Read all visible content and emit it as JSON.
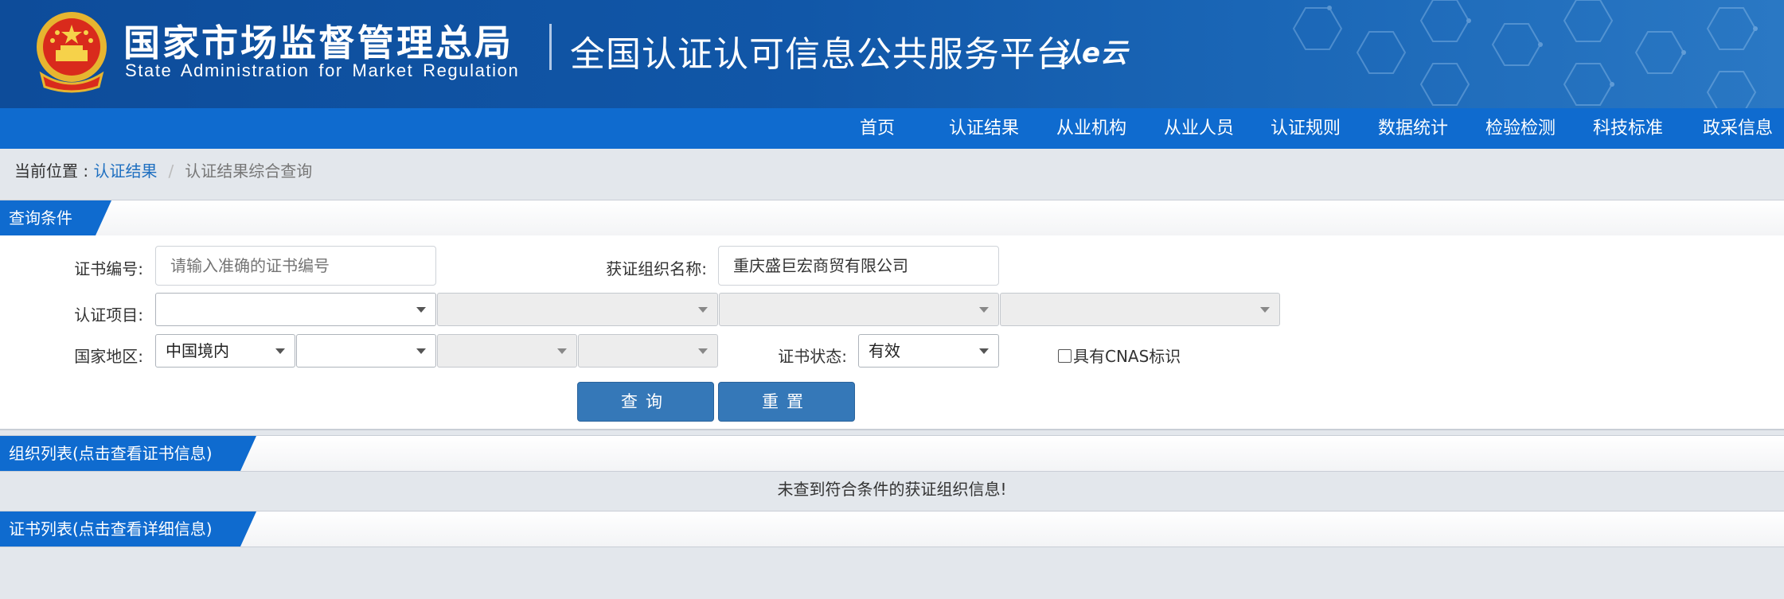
{
  "header": {
    "org_name_cn": "国家市场监督管理总局",
    "org_name_en": "State Administration  for  Market Regulation",
    "platform_title": "全国认证认可信息公共服务平台",
    "logo_text": "认e云",
    "colors": {
      "header_bg": "#1157a8",
      "nav_bg": "#0f6bcf",
      "accent": "#1e6fc0"
    }
  },
  "nav": {
    "items": [
      {
        "label": "首页"
      },
      {
        "label": "认证结果"
      },
      {
        "label": "从业机构"
      },
      {
        "label": "从业人员"
      },
      {
        "label": "认证规则"
      },
      {
        "label": "数据统计"
      },
      {
        "label": "检验检测"
      },
      {
        "label": "科技标准"
      },
      {
        "label": "政采信息"
      }
    ]
  },
  "breadcrumb": {
    "prefix": "当前位置 : ",
    "link": "认证结果",
    "separator": "/",
    "current": "认证结果综合查询"
  },
  "query_panel": {
    "title": "查询条件",
    "cert_no_label": "证书编号:",
    "cert_no_placeholder": "请输入准确的证书编号",
    "cert_no_value": "",
    "org_name_label": "获证组织名称:",
    "org_name_value": "重庆盛巨宏商贸有限公司",
    "project_label": "认证项目:",
    "project_selects": [
      "",
      "",
      "",
      ""
    ],
    "region_label": "国家地区:",
    "region_selects": [
      "中国境内",
      "",
      "",
      ""
    ],
    "status_label": "证书状态:",
    "status_value": "有效",
    "cnas_label": "具有CNAS标识",
    "cnas_checked": false,
    "search_button": "查询",
    "reset_button": "重置"
  },
  "org_panel": {
    "title": "组织列表(点击查看证书信息)",
    "empty_message": "未查到符合条件的获证组织信息!"
  },
  "cert_panel": {
    "title": "证书列表(点击查看详细信息)"
  }
}
